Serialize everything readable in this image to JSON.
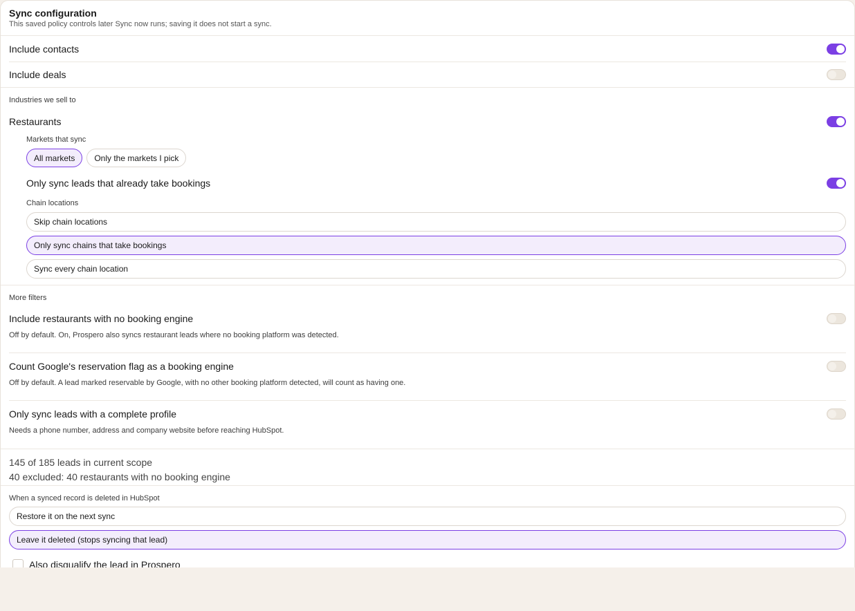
{
  "header": {
    "title": "Sync configuration",
    "subtitle": "This saved policy controls later Sync now runs; saving it does not start a sync."
  },
  "toggles": {
    "contacts": {
      "label": "Include contacts",
      "on": true
    },
    "deals": {
      "label": "Include deals",
      "on": false
    }
  },
  "industries": {
    "section_label": "Industries we sell to",
    "restaurants": {
      "label": "Restaurants",
      "on": true
    },
    "markets": {
      "label": "Markets that sync",
      "options": [
        "All markets",
        "Only the markets I pick"
      ],
      "selected": "All markets"
    },
    "bookings": {
      "label": "Only sync leads that already take bookings",
      "on": true
    },
    "chains": {
      "label": "Chain locations",
      "options": [
        "Skip chain locations",
        "Only sync chains that take bookings",
        "Sync every chain location"
      ],
      "selected": "Only sync chains that take bookings"
    }
  },
  "filters": {
    "section_label": "More filters",
    "items": [
      {
        "title": "Include restaurants with no booking engine",
        "desc": "Off by default. On, Prospero also syncs restaurant leads where no booking platform was detected.",
        "on": false
      },
      {
        "title": "Count Google's reservation flag as a booking engine",
        "desc": "Off by default. A lead marked reservable by Google, with no other booking platform detected, will count as having one.",
        "on": false
      },
      {
        "title": "Only sync leads with a complete profile",
        "desc": "Needs a phone number, address and company website before reaching HubSpot.",
        "on": false
      }
    ]
  },
  "scope": {
    "line1": "145 of 185 leads in current scope",
    "line2": "40 excluded: 40 restaurants with no booking engine"
  },
  "deletion": {
    "label": "When a synced record is deleted in HubSpot",
    "options": [
      "Restore it on the next sync",
      "Leave it deleted (stops syncing that lead)"
    ],
    "selected": "Leave it deleted (stops syncing that lead)",
    "disqualify": {
      "label": "Also disqualify the lead in Prospero",
      "checked": false
    }
  },
  "colors": {
    "accent": "#7b3fe4",
    "background": "#f5f0ea"
  }
}
